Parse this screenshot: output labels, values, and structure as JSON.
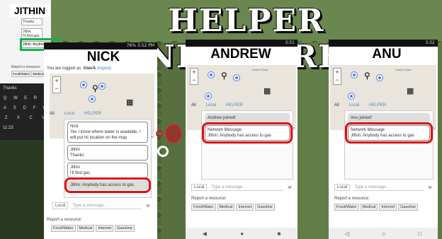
{
  "title": "HELPER NETWORK",
  "devices": {
    "jithin": {
      "name": "JITHIN",
      "draft": "Jithin: Anybody has",
      "mini_msgs": [
        "Thanks",
        "Jithin",
        "I'll find gas"
      ],
      "report_label": "Report a resource:",
      "report_btns": [
        "Food/Water",
        "Medical",
        "A"
      ],
      "keyboard_rows": [
        [
          "Q",
          "W",
          "E",
          "R",
          "T"
        ],
        [
          "A",
          "S",
          "D",
          "F",
          "G"
        ],
        [
          "Z",
          "X",
          "C",
          "V"
        ]
      ],
      "kbd_top": "Thanks",
      "time": "11:23"
    },
    "nick": {
      "name": "NICK",
      "status_time": "76% 3:52 PM",
      "logged_prefix": "You are logged as:",
      "user": "UserA",
      "logout": "(logout)",
      "tabs": [
        "All",
        "Local",
        "HELPER"
      ],
      "messages": [
        {
          "who": "Nick",
          "text": "Yes I know where water is available, I will put its location on the map"
        },
        {
          "who": "Jithin",
          "text": "Thanks"
        },
        {
          "who": "Jithin",
          "text": "I'll find gas"
        },
        {
          "who": "",
          "text": "Jithin: Anybody has access to gas"
        }
      ],
      "scope": "Local",
      "placeholder": "Type a message...",
      "report_label": "Report a resource:",
      "report_btns": [
        "Food/Water",
        "Medical",
        "Internet",
        "Gasoline"
      ],
      "leaflet": "Leaflet | © OpenStreetMap"
    },
    "andrew": {
      "name": "ANDREW",
      "status_time": "3:51",
      "tabs": [
        "All",
        "Local",
        "HELPER"
      ],
      "joined": "Andrew joined!",
      "net_title": "Network Message",
      "net_text": "Jithin: Anybody has access to gas",
      "scope": "Local",
      "placeholder": "Type a message...",
      "report_label": "Report a resource:",
      "report_btns": [
        "Food/Water",
        "Medical",
        "Internet",
        "Gasoline"
      ],
      "leaflet": "Leaflet | © OpenStreetMap",
      "road": "Parker Road"
    },
    "anu": {
      "name": "ANU",
      "status_time": "3:52",
      "tabs": [
        "All",
        "Local",
        "HELPER"
      ],
      "joined": "Anu joined!",
      "net_title": "Network Message",
      "net_text": "Jithin: Anybody has access to gas",
      "scope": "Local",
      "placeholder": "Type a message...",
      "report_label": "Report a resource:",
      "report_btns": [
        "Food/Water",
        "Medical",
        "Internet",
        "Gasoline"
      ],
      "leaflet": "Leaflet | © OpenStreetMap",
      "road": "Parker Road"
    }
  },
  "colors": {
    "highlight": "#e01010",
    "green": "#12b24a",
    "link": "#4a86c5"
  }
}
